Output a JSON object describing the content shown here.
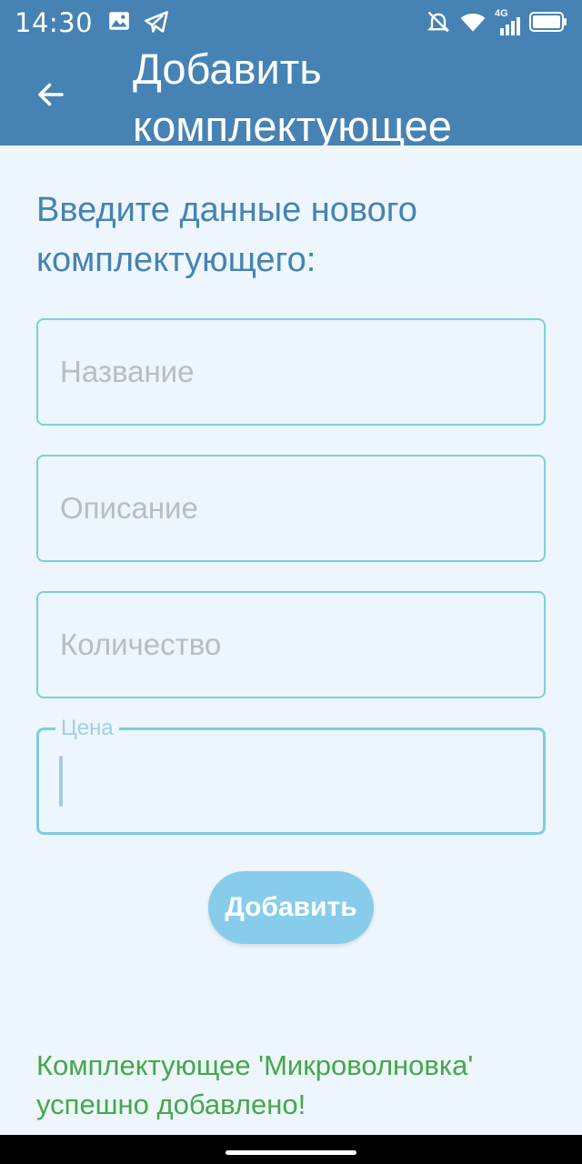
{
  "status_bar": {
    "time": "14:30",
    "left_icons": [
      "image-icon",
      "telegram-icon"
    ],
    "right_icons": [
      "bell-muted-icon",
      "wifi-icon",
      "signal-4g-icon",
      "battery-icon"
    ],
    "network_label": "4G"
  },
  "app_bar": {
    "title": "Добавить комплектующее",
    "back_icon": "arrow-left-icon",
    "color": "#4682b4"
  },
  "form": {
    "prompt": "Введите данные нового комплектующего:",
    "name": {
      "placeholder": "Название",
      "value": ""
    },
    "description": {
      "placeholder": "Описание",
      "value": ""
    },
    "quantity": {
      "placeholder": "Количество",
      "value": ""
    },
    "price": {
      "label": "Цена",
      "value": ""
    },
    "submit_label": "Добавить"
  },
  "message": {
    "text": "Комплектующее 'Микроволновка' успешно добавлено!",
    "color": "#45a74a"
  }
}
